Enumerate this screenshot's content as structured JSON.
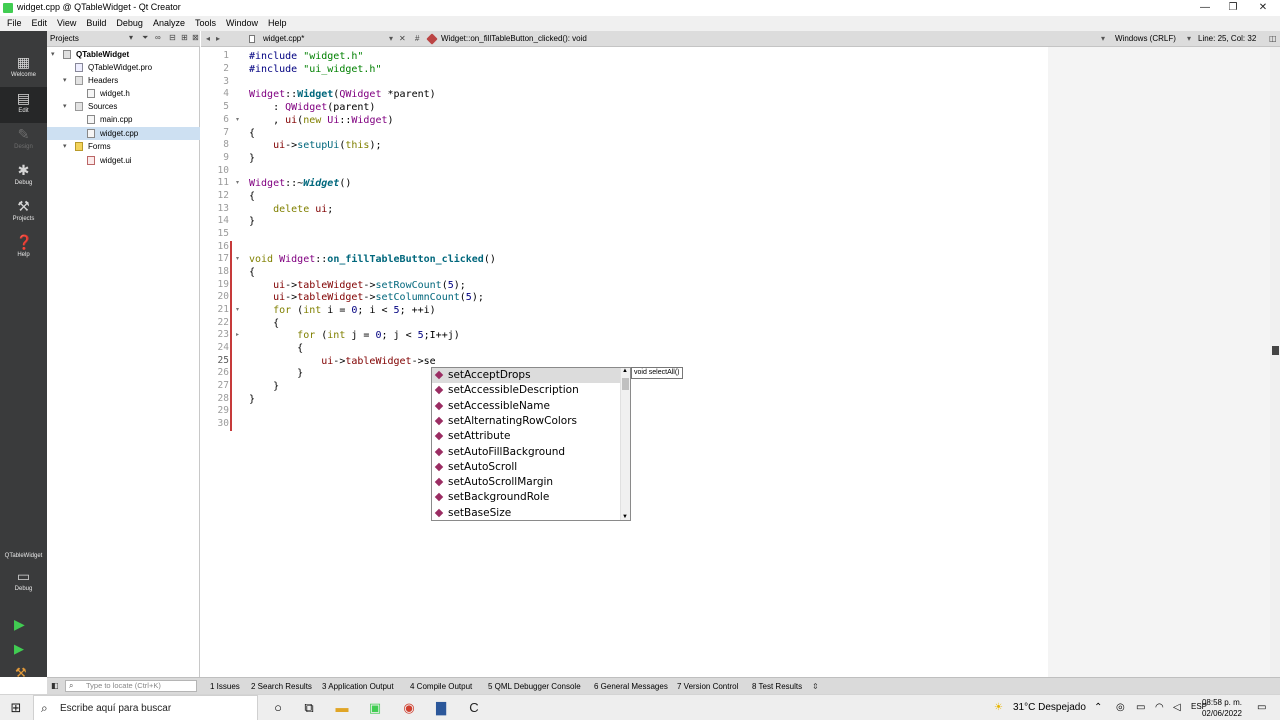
{
  "window": {
    "title": "widget.cpp @ QTableWidget - Qt Creator",
    "controls": [
      "—",
      "❐",
      "✕"
    ]
  },
  "menu": [
    "File",
    "Edit",
    "View",
    "Build",
    "Debug",
    "Analyze",
    "Tools",
    "Window",
    "Help"
  ],
  "modes": [
    {
      "label": "Welcome"
    },
    {
      "label": "Edit"
    },
    {
      "label": "Design"
    },
    {
      "label": "Debug"
    },
    {
      "label": "Projects"
    },
    {
      "label": "Help"
    }
  ],
  "kit": {
    "project": "QTableWidget",
    "mode": "Debug"
  },
  "projects_panel": {
    "title": "Projects",
    "tree": [
      {
        "label": "QTableWidget",
        "level": 0,
        "arrow": "▾",
        "icon": "project"
      },
      {
        "label": "QTableWidget.pro",
        "level": 1,
        "arrow": "",
        "icon": "pro"
      },
      {
        "label": "Headers",
        "level": 1,
        "arrow": "▾",
        "icon": "folder"
      },
      {
        "label": "widget.h",
        "level": 2,
        "arrow": "",
        "icon": "header"
      },
      {
        "label": "Sources",
        "level": 1,
        "arrow": "▾",
        "icon": "folder"
      },
      {
        "label": "main.cpp",
        "level": 2,
        "arrow": "",
        "icon": "cpp"
      },
      {
        "label": "widget.cpp",
        "level": 2,
        "arrow": "",
        "icon": "cpp",
        "selected": true
      },
      {
        "label": "Forms",
        "level": 1,
        "arrow": "▾",
        "icon": "forms"
      },
      {
        "label": "widget.ui",
        "level": 2,
        "arrow": "",
        "icon": "ui"
      }
    ]
  },
  "editor_toolbar": {
    "file": "widget.cpp*",
    "symbol": "Widget::on_fillTableButton_clicked(): void",
    "line_ending": "Windows (CRLF)",
    "position": "Line: 25, Col: 32"
  },
  "code": {
    "line_numbers": [
      "1",
      "2",
      "3",
      "4",
      "5",
      "6",
      "7",
      "8",
      "9",
      "10",
      "11",
      "12",
      "13",
      "14",
      "15",
      "16",
      "17",
      "18",
      "19",
      "20",
      "21",
      "22",
      "23",
      "24",
      "25",
      "26",
      "27",
      "28",
      "29",
      "30"
    ],
    "current_line": 25
  },
  "completion": {
    "items": [
      "setAcceptDrops",
      "setAccessibleDescription",
      "setAccessibleName",
      "setAlternatingRowColors",
      "setAttribute",
      "setAutoFillBackground",
      "setAutoScroll",
      "setAutoScrollMargin",
      "setBackgroundRole",
      "setBaseSize"
    ],
    "tooltip": "void selectAll()"
  },
  "output_bar": {
    "locate_placeholder": "Type to locate (Ctrl+K)",
    "tabs": [
      "1  Issues",
      "2  Search Results",
      "3  Application Output",
      "4  Compile Output",
      "5  QML Debugger Console",
      "6  General Messages",
      "7  Version Control",
      "8  Test Results"
    ]
  },
  "taskbar": {
    "search_placeholder": "Escribe aquí para buscar",
    "weather": "31°C  Despejado",
    "lang": "ESP",
    "time": "08:58 p. m.",
    "date": "02/06/2022"
  },
  "colors": {
    "modebar": "#3a3b3c",
    "accent_purple": "#9b2d63",
    "modified_marker": "#c63a3a"
  }
}
